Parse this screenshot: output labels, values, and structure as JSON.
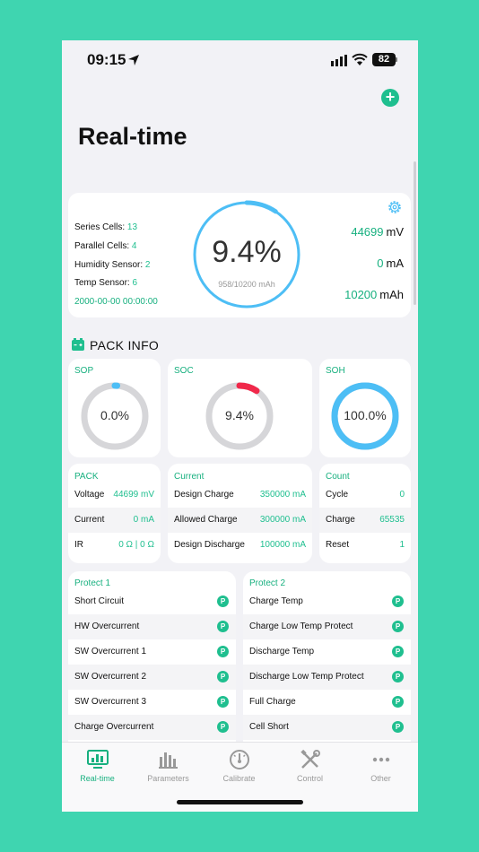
{
  "status_bar": {
    "time": "09:15",
    "battery": "82"
  },
  "header": {
    "title": "Real-time"
  },
  "summary": {
    "series_label": "Series Cells:",
    "series_value": "13",
    "parallel_label": "Parallel Cells:",
    "parallel_value": "4",
    "humidity_label": "Humidity Sensor:",
    "humidity_value": "2",
    "temp_label": "Temp Sensor:",
    "temp_value": "6",
    "datetime": "2000-00-00 00:00:00",
    "gauge_percent": "9.4%",
    "gauge_fraction": 0.094,
    "gauge_capacity": "958/10200 mAh",
    "voltage": {
      "value": "44699",
      "unit": "mV"
    },
    "current": {
      "value": "0",
      "unit": "mA"
    },
    "capacity": {
      "value": "10200",
      "unit": "mAh"
    }
  },
  "pack_info": {
    "title": "PACK INFO"
  },
  "rings": {
    "sop": {
      "label": "SOP",
      "value": "0.0%",
      "fraction": 0.0,
      "color": "#4dbef5"
    },
    "soc": {
      "label": "SOC",
      "value": "9.4%",
      "fraction": 0.094,
      "color": "#f0284a"
    },
    "soh": {
      "label": "SOH",
      "value": "100.0%",
      "fraction": 1.0,
      "color": "#4dbef5"
    },
    "track_color": "#d6d6d9"
  },
  "pack_table": {
    "title": "PACK",
    "rows": [
      {
        "k": "Voltage",
        "v": "44699 mV"
      },
      {
        "k": "Current",
        "v": "0 mA"
      },
      {
        "k": "IR",
        "v": "0 Ω | 0 Ω"
      }
    ]
  },
  "current_table": {
    "title": "Current",
    "rows": [
      {
        "k": "Design Charge",
        "v": "350000 mA"
      },
      {
        "k": "Allowed Charge",
        "v": "300000 mA"
      },
      {
        "k": "Design Discharge",
        "v": "100000 mA"
      }
    ]
  },
  "count_table": {
    "title": "Count",
    "rows": [
      {
        "k": "Cycle",
        "v": "0"
      },
      {
        "k": "Charge",
        "v": "65535"
      },
      {
        "k": "Reset",
        "v": "1"
      }
    ]
  },
  "protect1": {
    "title": "Protect 1",
    "badge": "P",
    "items": [
      "Short Circuit",
      "HW Overcurrent",
      "SW Overcurrent 1",
      "SW Overcurrent 2",
      "SW Overcurrent 3",
      "Charge Overcurrent"
    ]
  },
  "protect2": {
    "title": "Protect 2",
    "badge": "P",
    "items": [
      "Charge Temp",
      "Charge Low Temp Protect",
      "Discharge Temp",
      "Discharge Low Temp Protect",
      "Full Charge",
      "Cell Short"
    ]
  },
  "tabs": [
    {
      "label": "Real-time",
      "icon": "monitor-chart-icon"
    },
    {
      "label": "Parameters",
      "icon": "bar-chart-icon"
    },
    {
      "label": "Calibrate",
      "icon": "gauge-icon"
    },
    {
      "label": "Control",
      "icon": "tools-icon"
    },
    {
      "label": "Other",
      "icon": "more-dots-icon"
    }
  ],
  "colors": {
    "accent": "#1fbf8f",
    "background": "#3fd5b0",
    "gauge_blue": "#4dbef5",
    "soc_red": "#f0284a"
  }
}
